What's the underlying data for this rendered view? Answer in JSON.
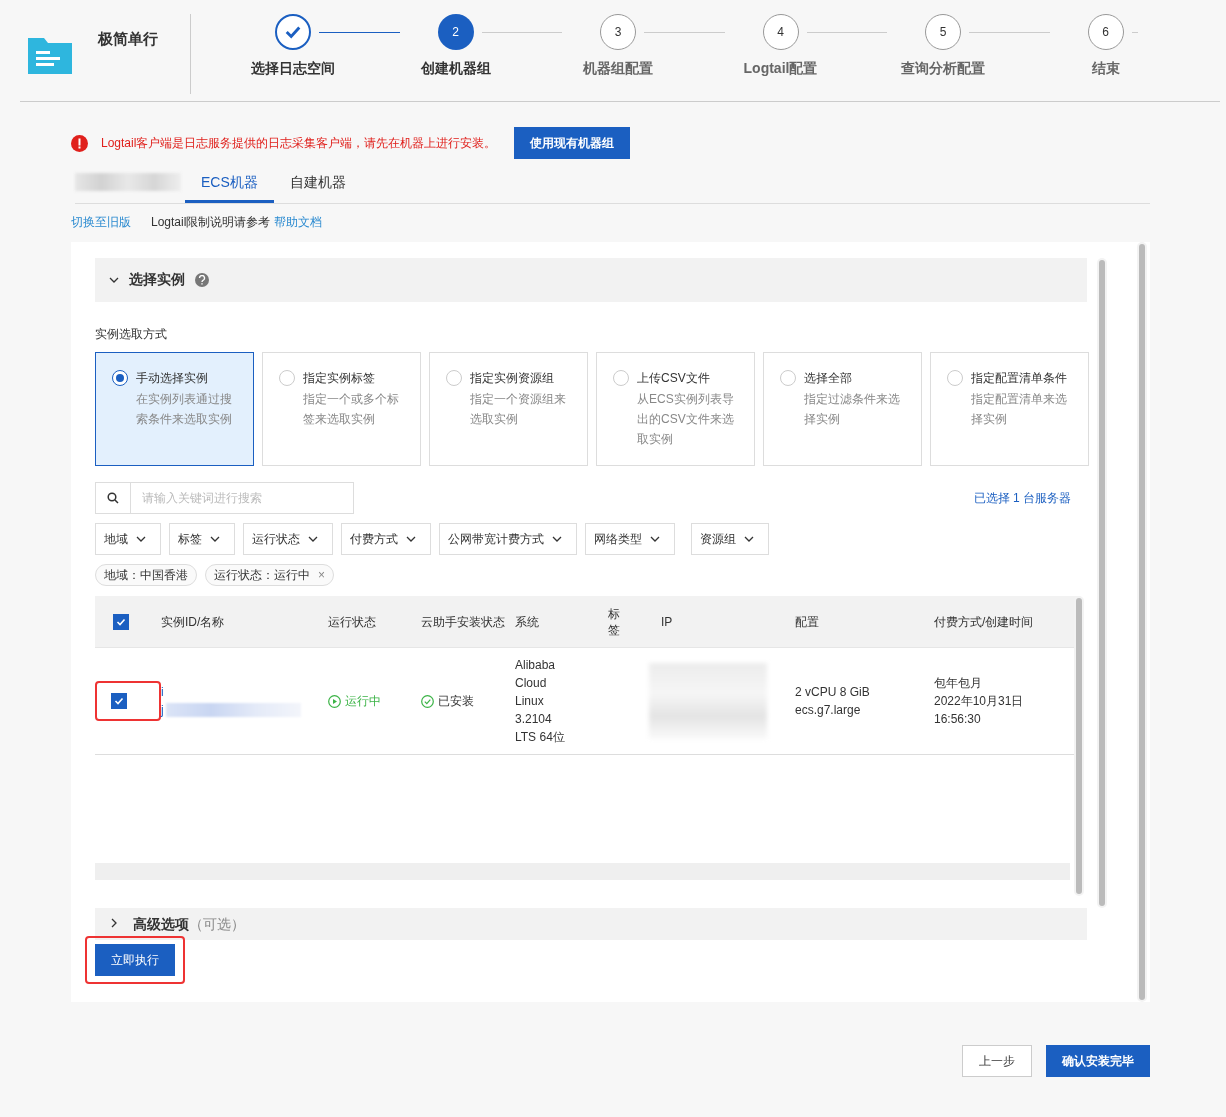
{
  "app": {
    "title": "极简单行"
  },
  "steps": [
    {
      "label": "选择日志空间",
      "completed": true,
      "selected": false
    },
    {
      "number": "2",
      "label": "创建机器组",
      "completed": false,
      "selected": true
    },
    {
      "number": "3",
      "label": "机器组配置",
      "completed": false,
      "selected": false
    },
    {
      "number": "4",
      "label": "Logtail配置",
      "completed": false,
      "selected": false
    },
    {
      "number": "5",
      "label": "查询分析配置",
      "completed": false,
      "selected": false
    },
    {
      "number": "6",
      "label": "结束",
      "completed": false,
      "selected": false
    }
  ],
  "alert": {
    "text": "Logtail客户端是日志服务提供的日志采集客户端，请先在机器上进行安装。",
    "button": "使用现有机器组"
  },
  "tabs": [
    {
      "label": "ECS机器",
      "selected": true
    },
    {
      "label": "自建机器",
      "selected": false
    }
  ],
  "links": {
    "switch": "切换至旧版",
    "note": "Logtail限制说明请参考",
    "help": "帮助文档"
  },
  "section": {
    "title": "选择实例",
    "expanded": true,
    "mode_label": "实例选取方式"
  },
  "modes": [
    {
      "title": "手动选择实例",
      "desc": "在实例列表通过搜索条件来选取实例",
      "selected": true
    },
    {
      "title": "指定实例标签",
      "desc": "指定一个或多个标签来选取实例",
      "selected": false
    },
    {
      "title": "指定实例资源组",
      "desc": "指定一个资源组来选取实例",
      "selected": false
    },
    {
      "title": "上传CSV文件",
      "desc": "从ECS实例列表导出的CSV文件来选取实例",
      "selected": false
    },
    {
      "title": "选择全部",
      "desc": "指定过滤条件来选择实例",
      "selected": false
    },
    {
      "title": "指定配置清单条件",
      "desc": "指定配置清单来选择实例",
      "selected": false
    }
  ],
  "search": {
    "placeholder": "请输入关键词进行搜索",
    "selected_count": "已选择 1 台服务器"
  },
  "filters": [
    "地域",
    "标签",
    "运行状态",
    "付费方式",
    "公网带宽计费方式",
    "网络类型",
    "资源组"
  ],
  "active_filters": [
    {
      "label": "地域：中国香港"
    },
    {
      "label": "运行状态：运行中",
      "remove": "×"
    }
  ],
  "table": {
    "all_checked": true,
    "columns": [
      "实例ID/名称",
      "运行状态",
      "云助手安装状态",
      "系统",
      "标签",
      "IP",
      "配置",
      "付费方式/创建时间"
    ],
    "rows": [
      {
        "checked": true,
        "id_lines": [
          "i",
          "j"
        ],
        "status": "运行中",
        "agent": "已安装",
        "os": [
          "Alibaba",
          "Cloud",
          "Linux",
          "3.2104",
          "LTS 64位"
        ],
        "config": [
          "2 vCPU 8 GiB",
          "ecs.g7.large"
        ],
        "billing": [
          "包年包月",
          "2022年10月31日",
          "16:56:30"
        ]
      }
    ]
  },
  "advanced": {
    "title": "高级选项",
    "hint": "（可选）",
    "expanded": false
  },
  "run_button": "立即执行",
  "footer": {
    "back": "上一步",
    "confirm": "确认安装完毕"
  }
}
